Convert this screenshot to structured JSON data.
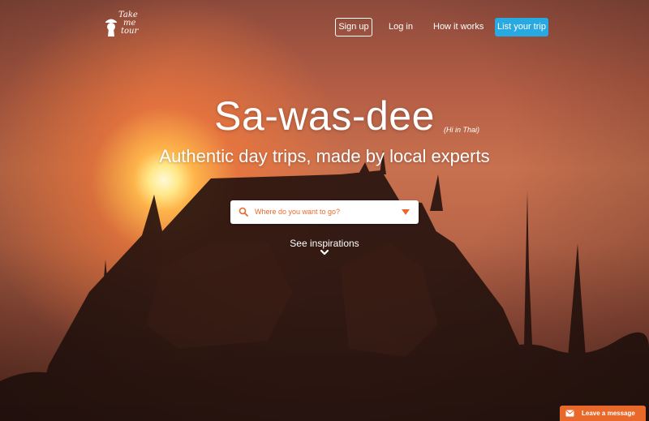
{
  "logo": {
    "lines": [
      "Take",
      "me",
      "tour"
    ],
    "color": "#ffffff"
  },
  "nav": {
    "signup": "Sign up",
    "login": "Log in",
    "how_it_works": "How it works",
    "list_trip": "List your trip",
    "accent": "#29a9e1"
  },
  "hero": {
    "title": "Sa-was-dee",
    "title_note": "(Hi in Thai)",
    "subtitle": "Authentic day trips, made by local experts"
  },
  "search": {
    "placeholder": "Where do you want to go?",
    "value": "",
    "icon": "search-icon",
    "dropdown_icon": "caret-down-icon",
    "accent": "#e8692a"
  },
  "inspirations": {
    "label": "See inspirations",
    "icon": "chevron-down-icon"
  },
  "chat": {
    "label": "Leave a message",
    "icon": "envelope-icon",
    "color": "#e8692a"
  }
}
